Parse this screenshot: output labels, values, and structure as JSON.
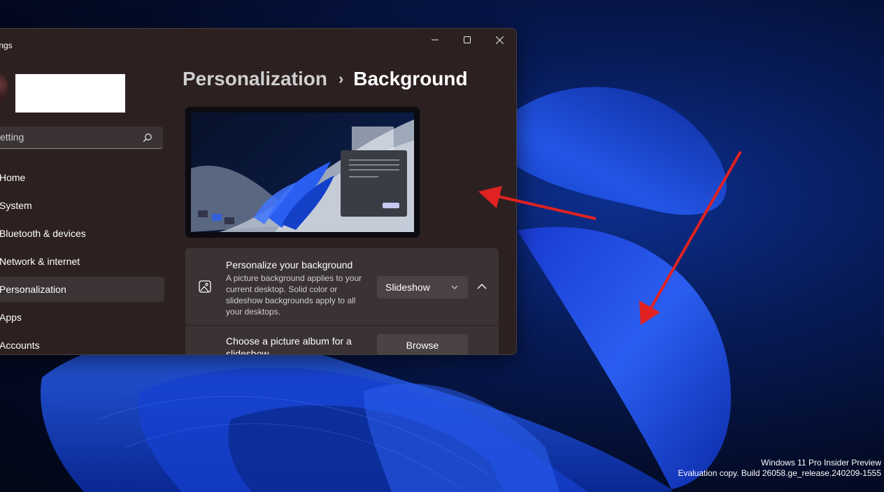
{
  "window": {
    "title": "ttings",
    "minimize_icon": "minimize-icon",
    "maximize_icon": "maximize-icon",
    "close_icon": "close-icon"
  },
  "sidebar": {
    "search_placeholder": "setting",
    "items": [
      {
        "label": "Home"
      },
      {
        "label": "System"
      },
      {
        "label": "Bluetooth & devices"
      },
      {
        "label": "Network & internet"
      },
      {
        "label": "Personalization",
        "selected": true
      },
      {
        "label": "Apps"
      },
      {
        "label": "Accounts"
      }
    ]
  },
  "breadcrumb": {
    "parent": "Personalization",
    "separator": "›",
    "current": "Background"
  },
  "background_card": {
    "title": "Personalize your background",
    "description": "A picture background applies to your current desktop. Solid color or slideshow backgrounds apply to all your desktops.",
    "dropdown_value": "Slideshow",
    "icon": "image-icon"
  },
  "album_card": {
    "title": "Choose a picture album for a slideshow",
    "button_label": "Browse"
  },
  "watermark": {
    "line1": "Windows 11 Pro Insider Preview",
    "line2": "Evaluation copy. Build 26058.ge_release.240209-1555"
  },
  "colors": {
    "window_bg": "#2c2021",
    "card_bg": "#3a3233",
    "annotation_arrow": "#e02222",
    "wallpaper_blue": "#1f4fe0"
  }
}
